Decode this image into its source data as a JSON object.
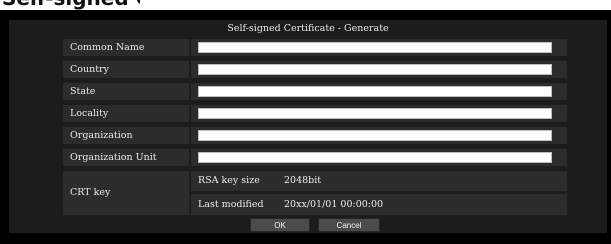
{
  "top_partial": {
    "text": "Self-signed Certificate - Generate"
  },
  "dialog": {
    "title": "Self-signed Certificate - Generate",
    "fields": [
      {
        "label": "Common Name",
        "value": ""
      },
      {
        "label": "Country",
        "value": ""
      },
      {
        "label": "State",
        "value": ""
      },
      {
        "label": "Locality",
        "value": ""
      },
      {
        "label": "Organization",
        "value": ""
      },
      {
        "label": "Organization Unit",
        "value": ""
      }
    ],
    "crt_key": {
      "label": "CRT key",
      "rsa_key_size_label": "RSA key size",
      "rsa_key_size_value": "2048bit",
      "last_modified_label": "Last modified",
      "last_modified_value": "20xx/01/01 00:00:00"
    },
    "buttons": {
      "ok": "OK",
      "cancel": "Cancel"
    }
  }
}
